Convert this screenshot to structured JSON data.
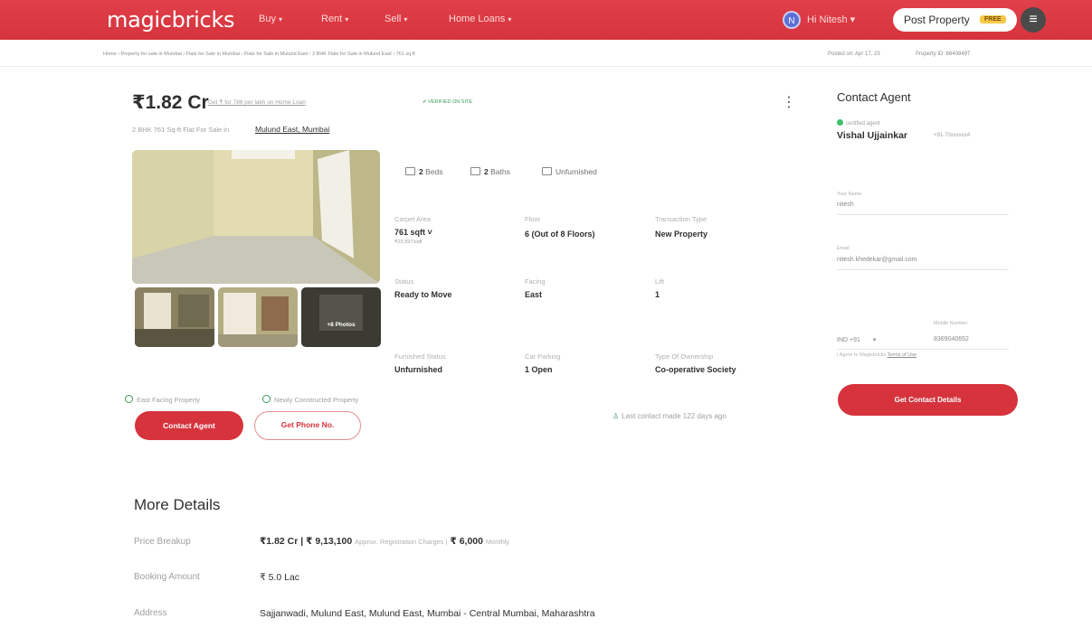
{
  "header": {
    "logo": "magicbricks",
    "nav": [
      {
        "label": "Buy"
      },
      {
        "label": "Rent"
      },
      {
        "label": "Sell"
      },
      {
        "label": "Home Loans"
      }
    ],
    "user_initial": "N",
    "user_label": "Hi Nitesh",
    "post_property_label": "Post Property",
    "post_property_badge": "FREE",
    "menu_icon": "hamburger-icon"
  },
  "breadcrumb": "Home › Property for sale in Mumbai › Flats for Sale in Mumbai › Flats for Sale in Mulund East › 2 BHK Flats for Sale in Mulund East › 761 sq ft",
  "posted_on": "Posted on: Apr 17, 23",
  "property_id": "Property ID: 66408497",
  "listing": {
    "price": "₹1.82 Cr",
    "emi_text": "Get ₹ for 786 per lakh on Home Loan",
    "verified": "✔ VERIFIED ON SITE",
    "subtitle_prefix": "2 BHK 761 Sq-ft Flat For Sale in",
    "subtitle_link": "Mulund East, Mumbai",
    "more_icon": "kebab-icon",
    "photos_count": "+8 Photos",
    "features": {
      "beds": "2",
      "beds_label": "Beds",
      "baths": "2",
      "baths_label": "Baths",
      "furnishing": "Unfurnished"
    },
    "details": {
      "carpet_area_label": "Carpet Area",
      "carpet_area_value": "761 sqft",
      "carpet_area_sub": "₹23,997/sqft",
      "floor_label": "Floor",
      "floor_value": "6 (Out of 8 Floors)",
      "transaction_label": "Transaction Type",
      "transaction_value": "New Property",
      "status_label": "Status",
      "status_value": "Ready to Move",
      "facing_label": "Facing",
      "facing_value": "East",
      "lift_label": "Lift",
      "lift_value": "1",
      "furnished_label": "Furnished Status",
      "furnished_value": "Unfurnished",
      "parking_label": "Car Parking",
      "parking_value": "1 Open",
      "ownership_label": "Type Of Ownership",
      "ownership_value": "Co-operative Society"
    },
    "tags": [
      "East Facing Property",
      "Newly Constructed Property"
    ],
    "contact_agent_label": "Contact Agent",
    "get_phone_label": "Get Phone No.",
    "last_contact": "Last contact made 122 days ago"
  },
  "contact_panel": {
    "title": "Contact Agent",
    "certified": "certified agent",
    "agent_name": "Vishal Ujjainkar",
    "agent_phone": "+91-70xxxxxx4",
    "name_label": "Your Name",
    "name_value": "nitesh",
    "email_label": "Email",
    "email_value": "nitesh.khedekar@gmail.com",
    "mobile_label": "Mobile Number",
    "country_code": "IND +91",
    "mobile_value": "8369040652",
    "agree_text": "I Agree to Magicbricks",
    "terms_link": "Terms of Use",
    "submit_label": "Get Contact Details"
  },
  "more_details": {
    "title": "More Details",
    "rows": [
      {
        "label": "Price Breakup",
        "value": "₹1.82 Cr | ₹ 9,13,100",
        "note": "Approx. Registration Charges |",
        "value2": "₹ 6,000",
        "note2": "Monthly"
      },
      {
        "label": "Booking Amount",
        "value": "₹ 5.0 Lac"
      },
      {
        "label": "Address",
        "value": "Sajjanwadi, Mulund East, Mulund East, Mumbai - Central Mumbai, Maharashtra"
      }
    ]
  }
}
